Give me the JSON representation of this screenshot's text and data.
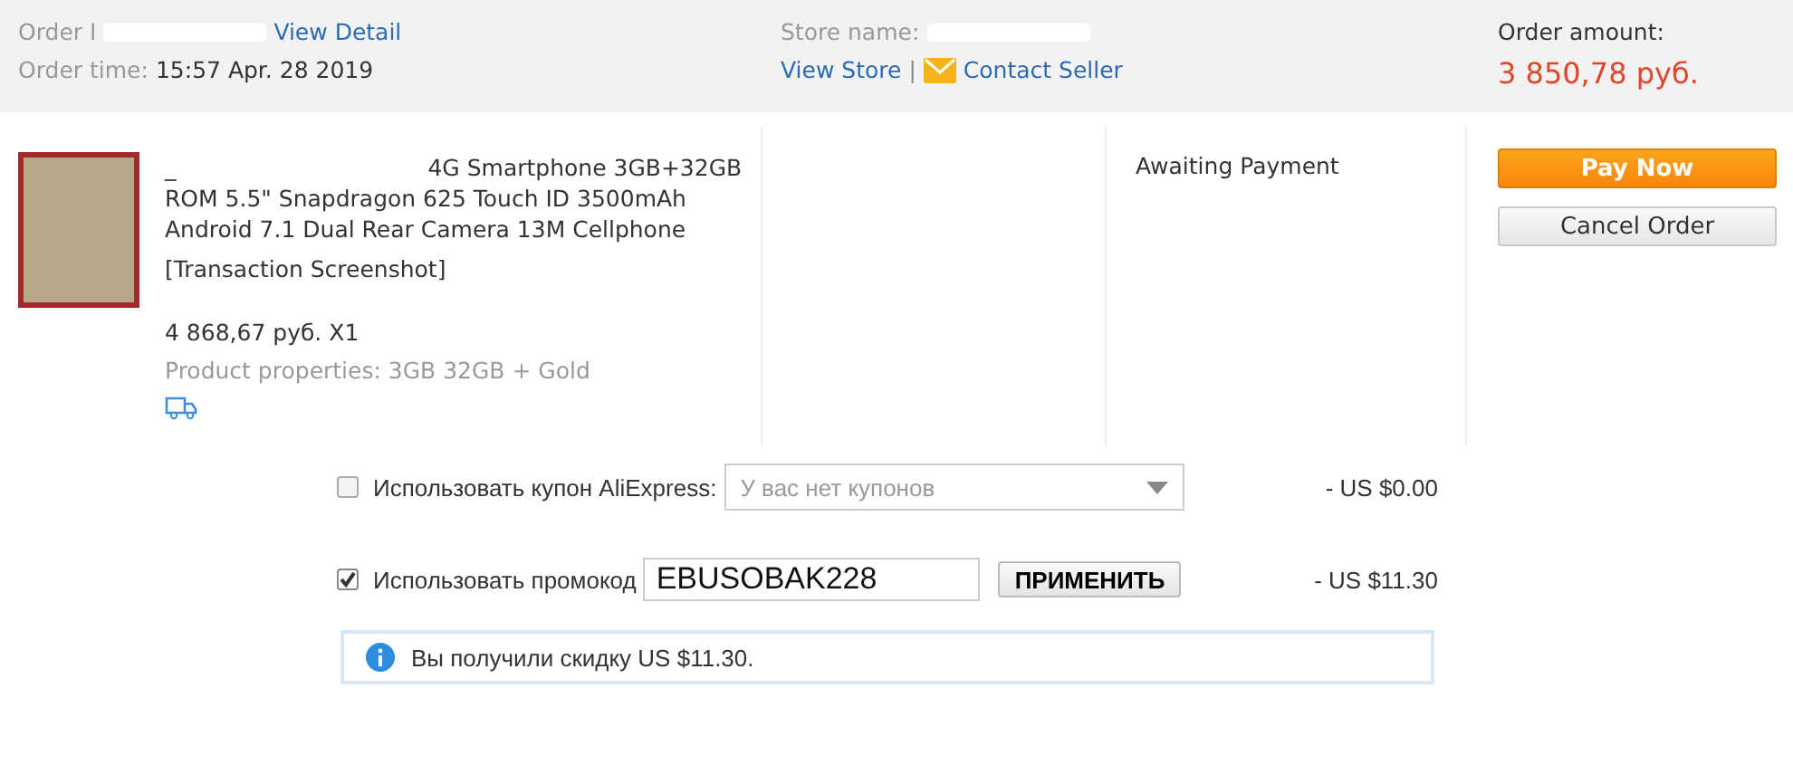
{
  "order_header": {
    "order_id_label": "Order I",
    "view_detail": "View Detail",
    "order_time_label": "Order time:",
    "order_time": "15:57 Apr. 28 2019",
    "store_name_label": "Store name:",
    "view_store": "View Store",
    "separator": "|",
    "contact_seller": "Contact Seller",
    "amount_label": "Order amount:",
    "amount": "3 850,78 руб."
  },
  "product": {
    "title_lines": [
      "_",
      "4G Smartphone 3GB+32GB ROM 5.5\" Snapdragon 625 Touch ID 3500mAh Android 7.1 Dual Rear Camera 13M Cellphone"
    ],
    "note": "[Transaction Screenshot]",
    "price": "4 868,67 руб. X1",
    "properties": "Product properties: 3GB 32GB + Gold"
  },
  "status": "Awaiting Payment",
  "actions": [
    {
      "label": "Pay Now",
      "kind": "primary"
    },
    {
      "label": "Cancel Order",
      "kind": "secondary"
    }
  ],
  "discounts": [
    {
      "kind": "select",
      "checked": false,
      "label": "Использовать купон AliExpress:",
      "placeholder": "У вас нет купонов",
      "amount": "- US $0.00"
    },
    {
      "kind": "code",
      "checked": true,
      "label": "Использовать промокод",
      "value": "EBUSOBAK228",
      "button": "ПРИМЕНИТЬ",
      "amount": "- US $11.30"
    }
  ],
  "notice": "Вы получили скидку US $11.30."
}
